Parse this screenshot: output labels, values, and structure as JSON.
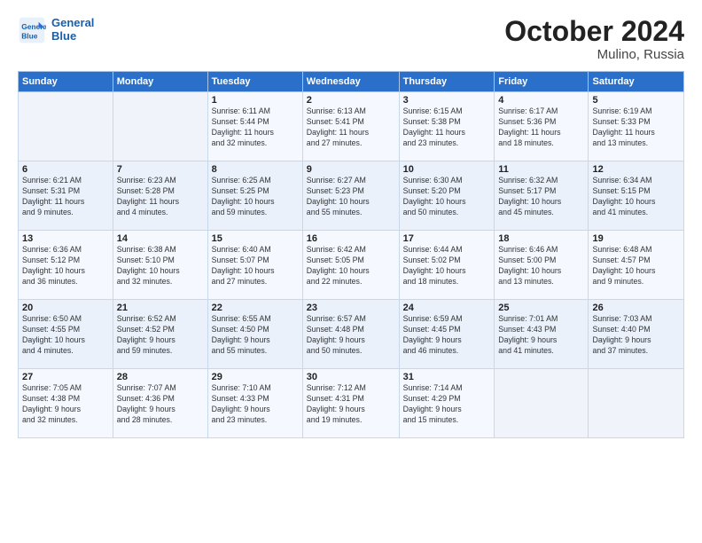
{
  "logo": {
    "line1": "General",
    "line2": "Blue"
  },
  "title": "October 2024",
  "location": "Mulino, Russia",
  "days_header": [
    "Sunday",
    "Monday",
    "Tuesday",
    "Wednesday",
    "Thursday",
    "Friday",
    "Saturday"
  ],
  "weeks": [
    [
      {
        "num": "",
        "info": ""
      },
      {
        "num": "",
        "info": ""
      },
      {
        "num": "1",
        "info": "Sunrise: 6:11 AM\nSunset: 5:44 PM\nDaylight: 11 hours\nand 32 minutes."
      },
      {
        "num": "2",
        "info": "Sunrise: 6:13 AM\nSunset: 5:41 PM\nDaylight: 11 hours\nand 27 minutes."
      },
      {
        "num": "3",
        "info": "Sunrise: 6:15 AM\nSunset: 5:38 PM\nDaylight: 11 hours\nand 23 minutes."
      },
      {
        "num": "4",
        "info": "Sunrise: 6:17 AM\nSunset: 5:36 PM\nDaylight: 11 hours\nand 18 minutes."
      },
      {
        "num": "5",
        "info": "Sunrise: 6:19 AM\nSunset: 5:33 PM\nDaylight: 11 hours\nand 13 minutes."
      }
    ],
    [
      {
        "num": "6",
        "info": "Sunrise: 6:21 AM\nSunset: 5:31 PM\nDaylight: 11 hours\nand 9 minutes."
      },
      {
        "num": "7",
        "info": "Sunrise: 6:23 AM\nSunset: 5:28 PM\nDaylight: 11 hours\nand 4 minutes."
      },
      {
        "num": "8",
        "info": "Sunrise: 6:25 AM\nSunset: 5:25 PM\nDaylight: 10 hours\nand 59 minutes."
      },
      {
        "num": "9",
        "info": "Sunrise: 6:27 AM\nSunset: 5:23 PM\nDaylight: 10 hours\nand 55 minutes."
      },
      {
        "num": "10",
        "info": "Sunrise: 6:30 AM\nSunset: 5:20 PM\nDaylight: 10 hours\nand 50 minutes."
      },
      {
        "num": "11",
        "info": "Sunrise: 6:32 AM\nSunset: 5:17 PM\nDaylight: 10 hours\nand 45 minutes."
      },
      {
        "num": "12",
        "info": "Sunrise: 6:34 AM\nSunset: 5:15 PM\nDaylight: 10 hours\nand 41 minutes."
      }
    ],
    [
      {
        "num": "13",
        "info": "Sunrise: 6:36 AM\nSunset: 5:12 PM\nDaylight: 10 hours\nand 36 minutes."
      },
      {
        "num": "14",
        "info": "Sunrise: 6:38 AM\nSunset: 5:10 PM\nDaylight: 10 hours\nand 32 minutes."
      },
      {
        "num": "15",
        "info": "Sunrise: 6:40 AM\nSunset: 5:07 PM\nDaylight: 10 hours\nand 27 minutes."
      },
      {
        "num": "16",
        "info": "Sunrise: 6:42 AM\nSunset: 5:05 PM\nDaylight: 10 hours\nand 22 minutes."
      },
      {
        "num": "17",
        "info": "Sunrise: 6:44 AM\nSunset: 5:02 PM\nDaylight: 10 hours\nand 18 minutes."
      },
      {
        "num": "18",
        "info": "Sunrise: 6:46 AM\nSunset: 5:00 PM\nDaylight: 10 hours\nand 13 minutes."
      },
      {
        "num": "19",
        "info": "Sunrise: 6:48 AM\nSunset: 4:57 PM\nDaylight: 10 hours\nand 9 minutes."
      }
    ],
    [
      {
        "num": "20",
        "info": "Sunrise: 6:50 AM\nSunset: 4:55 PM\nDaylight: 10 hours\nand 4 minutes."
      },
      {
        "num": "21",
        "info": "Sunrise: 6:52 AM\nSunset: 4:52 PM\nDaylight: 9 hours\nand 59 minutes."
      },
      {
        "num": "22",
        "info": "Sunrise: 6:55 AM\nSunset: 4:50 PM\nDaylight: 9 hours\nand 55 minutes."
      },
      {
        "num": "23",
        "info": "Sunrise: 6:57 AM\nSunset: 4:48 PM\nDaylight: 9 hours\nand 50 minutes."
      },
      {
        "num": "24",
        "info": "Sunrise: 6:59 AM\nSunset: 4:45 PM\nDaylight: 9 hours\nand 46 minutes."
      },
      {
        "num": "25",
        "info": "Sunrise: 7:01 AM\nSunset: 4:43 PM\nDaylight: 9 hours\nand 41 minutes."
      },
      {
        "num": "26",
        "info": "Sunrise: 7:03 AM\nSunset: 4:40 PM\nDaylight: 9 hours\nand 37 minutes."
      }
    ],
    [
      {
        "num": "27",
        "info": "Sunrise: 7:05 AM\nSunset: 4:38 PM\nDaylight: 9 hours\nand 32 minutes."
      },
      {
        "num": "28",
        "info": "Sunrise: 7:07 AM\nSunset: 4:36 PM\nDaylight: 9 hours\nand 28 minutes."
      },
      {
        "num": "29",
        "info": "Sunrise: 7:10 AM\nSunset: 4:33 PM\nDaylight: 9 hours\nand 23 minutes."
      },
      {
        "num": "30",
        "info": "Sunrise: 7:12 AM\nSunset: 4:31 PM\nDaylight: 9 hours\nand 19 minutes."
      },
      {
        "num": "31",
        "info": "Sunrise: 7:14 AM\nSunset: 4:29 PM\nDaylight: 9 hours\nand 15 minutes."
      },
      {
        "num": "",
        "info": ""
      },
      {
        "num": "",
        "info": ""
      }
    ]
  ]
}
